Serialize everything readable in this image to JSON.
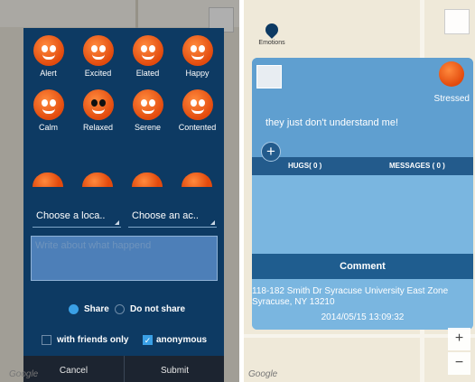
{
  "left": {
    "emotions": [
      {
        "label": "Alert"
      },
      {
        "label": "Excited"
      },
      {
        "label": "Elated"
      },
      {
        "label": "Happy"
      },
      {
        "label": "Calm"
      },
      {
        "label": "Relaxed"
      },
      {
        "label": "Serene"
      },
      {
        "label": "Contented"
      }
    ],
    "location_select": "Choose a loca..",
    "activity_select": "Choose an ac..",
    "text_placeholder": "Write about what happend",
    "share_label": "Share",
    "no_share_label": "Do not share",
    "friends_only_label": "with friends only",
    "anonymous_label": "anonymous",
    "cancel_label": "Cancel",
    "submit_label": "Submit",
    "google_label": "Google"
  },
  "right": {
    "marker_label": "Emotions",
    "emotion_label": "Stressed",
    "post_text": "they just don't understand me!",
    "hugs_label": "HUGS( 0 )",
    "messages_label": "MESSAGES ( 0 )",
    "comment_label": "Comment",
    "address_line1": "118-182 Smith Dr Syracuse University East Zone",
    "address_line2": "Syracuse, NY 13210",
    "timestamp": "2014/05/15 13:09:32",
    "zoom_in": "+",
    "zoom_out": "−",
    "google_label": "Google"
  },
  "colors": {
    "dialog_bg": "#0d3a63",
    "card_bg": "#7ab6e0",
    "accent": "#3aa0e6",
    "emotion_orange": "#e24a0d"
  }
}
